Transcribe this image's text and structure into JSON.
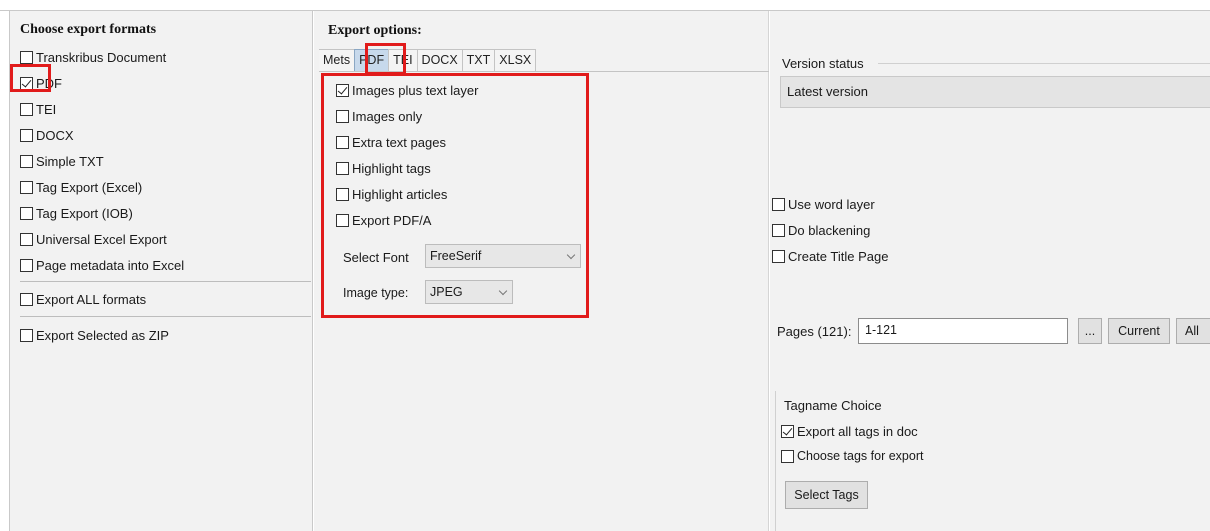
{
  "left_panel": {
    "title": "Choose export formats",
    "formats": [
      {
        "label": "Transkribus Document",
        "checked": false
      },
      {
        "label": "PDF",
        "checked": true
      },
      {
        "label": "TEI",
        "checked": false
      },
      {
        "label": "DOCX",
        "checked": false
      },
      {
        "label": "Simple TXT",
        "checked": false
      },
      {
        "label": "Tag Export (Excel)",
        "checked": false
      },
      {
        "label": "Tag Export (IOB)",
        "checked": false
      },
      {
        "label": "Universal Excel Export",
        "checked": false
      },
      {
        "label": "Page metadata into Excel",
        "checked": false
      }
    ],
    "export_all": {
      "label": "Export ALL formats",
      "checked": false
    },
    "export_zip": {
      "label": "Export Selected as ZIP",
      "checked": false
    }
  },
  "export_options": {
    "title": "Export options:",
    "tabs": [
      "Mets",
      "PDF",
      "TEI",
      "DOCX",
      "TXT",
      "XLSX"
    ],
    "active_tab": "PDF",
    "pdf": {
      "images_plus_text_layer": {
        "label": "Images plus text layer",
        "checked": true
      },
      "images_only": {
        "label": "Images only",
        "checked": false
      },
      "extra_text_pages": {
        "label": "Extra text pages",
        "checked": false
      },
      "highlight_tags": {
        "label": "Highlight tags",
        "checked": false
      },
      "highlight_articles": {
        "label": "Highlight articles",
        "checked": false
      },
      "export_pdfa": {
        "label": "Export PDF/A",
        "checked": false
      },
      "select_font_label": "Select Font",
      "select_font_value": "FreeSerif",
      "image_type_label": "Image type:",
      "image_type_value": "JPEG"
    }
  },
  "right_panel": {
    "version_status_label": "Version status",
    "version_status_value": "Latest version",
    "use_word_layer": {
      "label": "Use word layer",
      "checked": false
    },
    "do_blackening": {
      "label": "Do blackening",
      "checked": false
    },
    "create_title_page": {
      "label": "Create Title Page",
      "checked": false
    },
    "pages_label": "Pages (121):",
    "pages_value": "1-121",
    "ellipsis_button": "...",
    "current_button": "Current",
    "all_button": "All",
    "tagname_choice_label": "Tagname Choice",
    "export_all_tags": {
      "label": "Export all tags in doc",
      "checked": true
    },
    "choose_tags": {
      "label": "Choose tags for export",
      "checked": false
    },
    "select_tags_button": "Select Tags"
  },
  "colors": {
    "highlight_red": "#e11b1b",
    "active_tab": "#c7d9ec",
    "panel_bg": "#f2f2f2"
  }
}
